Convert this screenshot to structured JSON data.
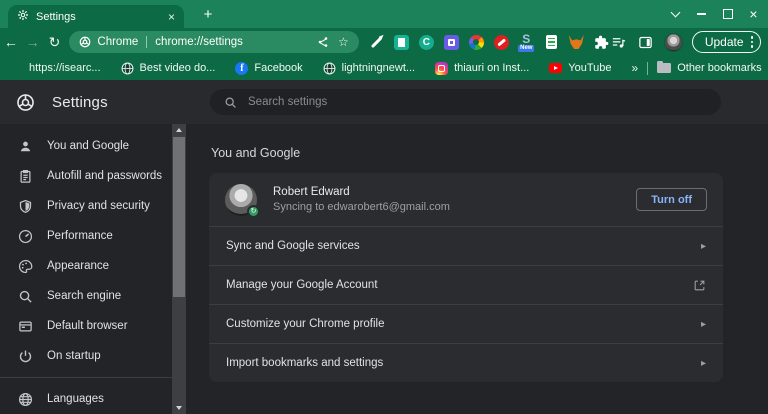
{
  "window": {
    "tab_title": "Settings"
  },
  "glyphs": {
    "tab_close": "×",
    "new_tab": "+",
    "back": "←",
    "forward": "→",
    "reload": "↻",
    "star": "☆",
    "overflow": "»",
    "row_chevron": "▸",
    "sync": "↻"
  },
  "toolbar": {
    "url_brand": "Chrome",
    "url": "chrome://settings",
    "update_label": "Update",
    "extension_c_glyph": "C",
    "extension_s_glyph": "S",
    "extension_s_badge": "New"
  },
  "bookmarks": {
    "items": [
      {
        "label": "https://isearc...",
        "icon": "grid-favicon"
      },
      {
        "label": "Best video do...",
        "icon": "globe-favicon"
      },
      {
        "label": "Facebook",
        "icon": "facebook-favicon",
        "glyph": "f"
      },
      {
        "label": "lightningnewt...",
        "icon": "globe-favicon"
      },
      {
        "label": "thiauri on Inst...",
        "icon": "instagram-favicon"
      },
      {
        "label": "YouTube",
        "icon": "youtube-favicon"
      }
    ],
    "other_bookmarks_label": "Other bookmarks"
  },
  "settings": {
    "header": {
      "title": "Settings",
      "search_placeholder": "Search settings"
    },
    "sidebar": [
      {
        "label": "You and Google"
      },
      {
        "label": "Autofill and passwords"
      },
      {
        "label": "Privacy and security"
      },
      {
        "label": "Performance"
      },
      {
        "label": "Appearance"
      },
      {
        "label": "Search engine"
      },
      {
        "label": "Default browser"
      },
      {
        "label": "On startup"
      },
      {
        "label": "Languages"
      }
    ],
    "section_title": "You and Google",
    "profile": {
      "name": "Robert Edward",
      "status": "Syncing to edwarobert6@gmail.com",
      "turn_off_label": "Turn off"
    },
    "rows": [
      {
        "label": "Sync and Google services",
        "trailing": "chevron"
      },
      {
        "label": "Manage your Google Account",
        "trailing": "external-link"
      },
      {
        "label": "Customize your Chrome profile",
        "trailing": "chevron"
      },
      {
        "label": "Import bookmarks and settings",
        "trailing": "chevron"
      }
    ]
  },
  "colors": {
    "frame_green": "#1b8259",
    "toolbar_green": "#0c6a45",
    "omnibox_green": "#2a8a61",
    "page_bg": "#232428",
    "header_bg": "#292a2d",
    "card_bg": "#2b2c30",
    "text_primary": "#e8eaed",
    "text_secondary": "#9aa0a6",
    "accent_blue": "#8ab4f8",
    "new_badge_blue": "#3b78e8"
  }
}
